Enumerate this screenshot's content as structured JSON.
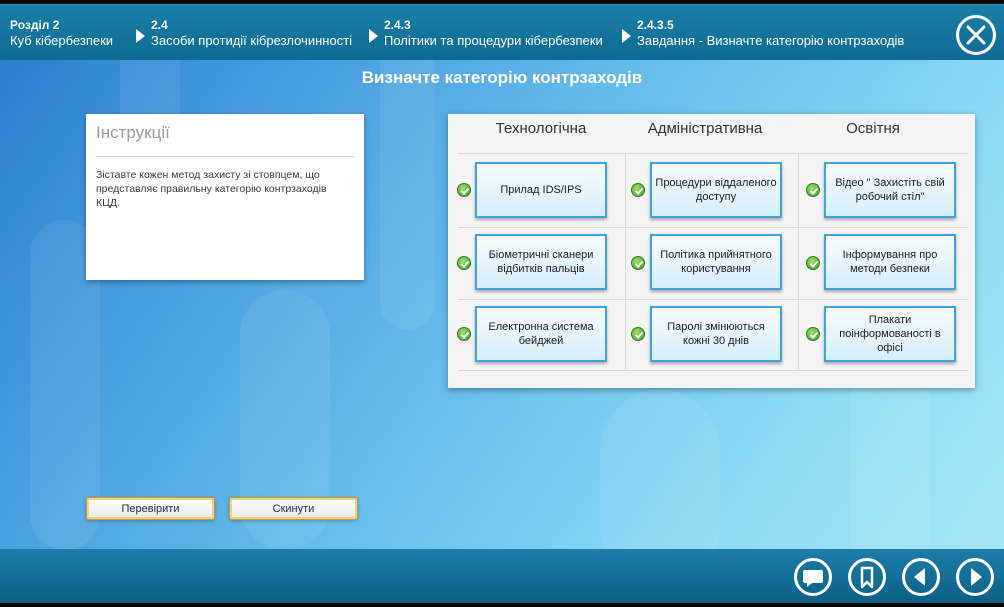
{
  "breadcrumb": [
    {
      "num": "Розділ 2",
      "text": "Куб кібербезпеки"
    },
    {
      "num": "2.4",
      "text": "Засоби протидії кібрезлочинності"
    },
    {
      "num": "2.4.3",
      "text": "Політики та процедури кібербезпеки"
    },
    {
      "num": "2.4.3.5",
      "text": "Завдання - Визначте категорію контрзаходів"
    }
  ],
  "page_title": "Визначте категорію контрзаходів",
  "instructions": {
    "title": "Інструкції",
    "text": "Зіставте кожен метод захисту зі стовпцем, що представляє правильну категорію контрзаходів КЦД."
  },
  "buttons": {
    "check": "Перевірити",
    "reset": "Скинути"
  },
  "columns": [
    "Технологічна",
    "Адміністративна",
    "Освітня"
  ],
  "rows": [
    [
      "Прилад IDS/IPS",
      "Процедури віддаленого доступу",
      "Відео \" Захистіть свій робочий стіл\""
    ],
    [
      "Біометричні сканери відбитків пальців",
      "Політика прийнятного користування",
      "Інформування про методи безпеки"
    ],
    [
      "Електронна система бейджей",
      "Паролі змінюються кожні 30 днів",
      "Плакати поінформованості в офісі"
    ]
  ],
  "status": {
    "all_correct": true
  },
  "icons": {
    "close": "close-icon",
    "check": "check-icon",
    "breadcrumb_separator": "arrow-right-icon",
    "footer": [
      "comment-icon",
      "bookmark-icon",
      "previous-icon",
      "next-icon"
    ]
  },
  "colors": {
    "header": "#1479a3",
    "footer": "#0f6a93",
    "tile_border": "#3fa4dc",
    "check": "#4caf3a",
    "button_border": "#c29a3c"
  }
}
